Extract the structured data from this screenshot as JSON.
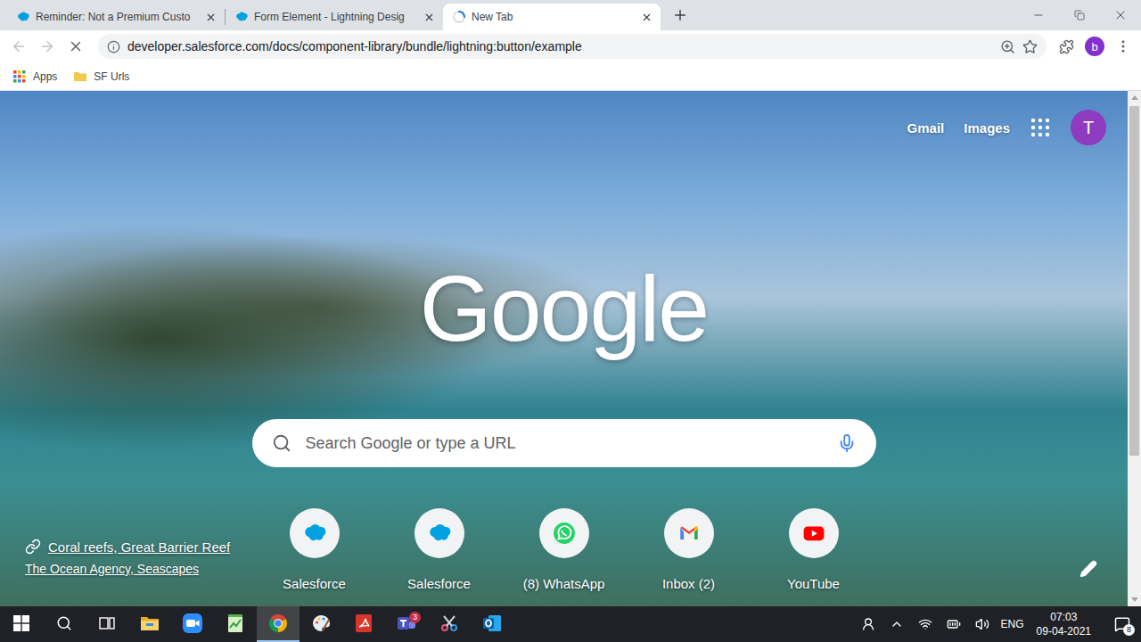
{
  "tabs": [
    {
      "title": "Reminder: Not a Premium Custo",
      "selected": false,
      "loading": false
    },
    {
      "title": "Form Element - Lightning Desig",
      "selected": false,
      "loading": false
    },
    {
      "title": "New Tab",
      "selected": true,
      "loading": true
    }
  ],
  "toolbar": {
    "nav": [
      {
        "kind": "back",
        "disabled": true
      },
      {
        "kind": "forward",
        "disabled": true
      },
      {
        "kind": "stop",
        "disabled": false
      }
    ],
    "url": "developer.salesforce.com/docs/component-library/bundle/lightning:button/example",
    "bookmarked": false,
    "profile": "b"
  },
  "bookmarks": [
    {
      "label": "Apps",
      "kind": "apps"
    },
    {
      "label": "SF Urls",
      "kind": "folder"
    }
  ],
  "page": {
    "header_links": [
      "Gmail",
      "Images"
    ],
    "account": "T",
    "logo": "Google",
    "search": {
      "placeholder": "Search Google or type a URL"
    },
    "shortcuts": [
      {
        "label": "Salesforce",
        "kind": "salesforce"
      },
      {
        "label": "Salesforce",
        "kind": "salesforce"
      },
      {
        "label": "(8) WhatsApp",
        "kind": "whatsapp"
      },
      {
        "label": "Inbox (2)",
        "kind": "gmail"
      },
      {
        "label": "YouTube",
        "kind": "youtube"
      }
    ],
    "background": {
      "title": "Coral reefs, Great Barrier Reef",
      "credit": "The Ocean Agency, Seascapes"
    },
    "scrollbar": {
      "level": 0.72
    }
  },
  "taskbar": {
    "apps": [
      {
        "kind": "explorer",
        "active": false
      },
      {
        "kind": "zoom",
        "active": false
      },
      {
        "kind": "notepad",
        "active": false
      },
      {
        "kind": "chrome",
        "active": true
      },
      {
        "kind": "paint",
        "active": false
      },
      {
        "kind": "pdf",
        "active": false
      },
      {
        "kind": "teams",
        "active": false,
        "badge": "3"
      },
      {
        "kind": "snip",
        "active": false
      },
      {
        "kind": "outlook",
        "active": false
      }
    ],
    "language": "ENG",
    "time": "07:03",
    "date": "09-04-2021",
    "notifications": "8"
  }
}
